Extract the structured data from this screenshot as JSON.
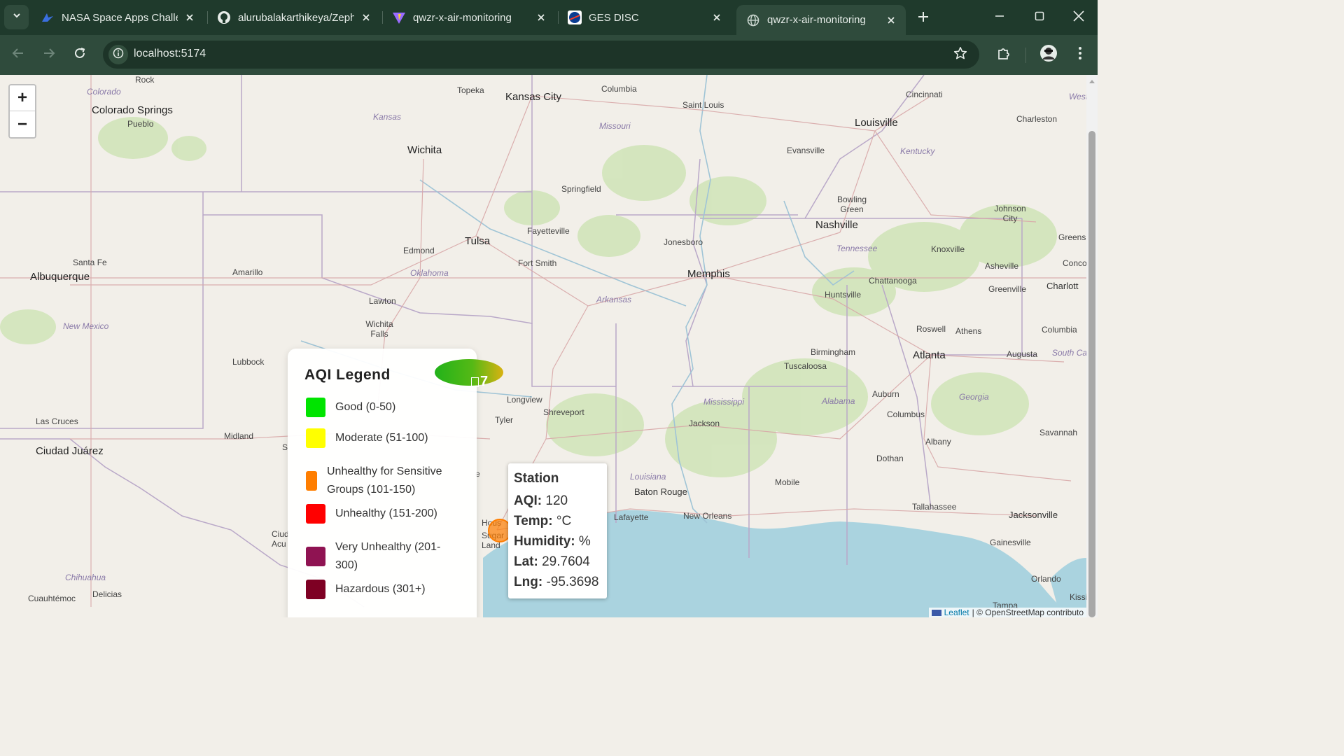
{
  "browser": {
    "tabs": [
      {
        "title": "NASA Space Apps Challe",
        "icon": "space-apps-icon"
      },
      {
        "title": "alurubalakarthikeya/Zeph",
        "icon": "github-icon"
      },
      {
        "title": "qwzr-x-air-monitoring",
        "icon": "vite-icon"
      },
      {
        "title": "GES DISC",
        "icon": "nasa-icon"
      },
      {
        "title": "qwzr-x-air-monitoring",
        "icon": "globe-icon",
        "active": true
      }
    ],
    "url": "localhost:5174"
  },
  "map": {
    "zoom_in_label": "+",
    "zoom_out_label": "−",
    "labels": {
      "rock": "Rock",
      "colorado": "Colorado",
      "colorado_springs": "Colorado Springs",
      "pueblo": "Pueblo",
      "kansas": "Kansas",
      "topeka": "Topeka",
      "kansas_city": "Kansas City",
      "columbia_mo": "Columbia",
      "saint_louis": "Saint Louis",
      "missouri": "Missouri",
      "cincinnati": "Cincinnati",
      "louisville": "Louisville",
      "charleston": "Charleston",
      "wichita": "Wichita",
      "evansville": "Evansville",
      "kentucky": "Kentucky",
      "springfield": "Springfield",
      "bowling_green": "Bowling Green",
      "johnson_city": "Johnson City",
      "fayetteville": "Fayetteville",
      "nashville": "Nashville",
      "tulsa": "Tulsa",
      "edmond": "Edmond",
      "jonesboro": "Jonesboro",
      "tennessee": "Tennessee",
      "knoxville": "Knoxville",
      "greens": "Greens",
      "santa_fe": "Santa Fe",
      "albuquerque": "Albuquerque",
      "amarillo": "Amarillo",
      "oklahoma": "Oklahoma",
      "fort_smith": "Fort Smith",
      "memphis": "Memphis",
      "chattanooga": "Chattanooga",
      "asheville": "Asheville",
      "conco": "Conco",
      "charlotte": "Charlott",
      "greenville": "Greenville",
      "huntsville": "Huntsville",
      "lawton": "Lawton",
      "arkansas": "Arkansas",
      "new_mexico": "New Mexico",
      "wichita_falls": "Wichita Falls",
      "roswell": "Roswell",
      "athens": "Athens",
      "columbia_sc": "Columbia",
      "birmingham": "Birmingham",
      "lubbock": "Lubbock",
      "atlanta": "Atlanta",
      "augusta": "Augusta",
      "south_ca": "South Ca",
      "tuscaloosa": "Tuscaloosa",
      "longview": "Longview",
      "shreveport": "Shreveport",
      "auburn": "Auburn",
      "mississippi": "Mississippi",
      "alabama": "Alabama",
      "georgia": "Georgia",
      "columbus": "Columbus",
      "las_cruces": "Las Cruces",
      "tyler": "Tyler",
      "jackson": "Jackson",
      "midland": "Midland",
      "savannah": "Savannah",
      "albany": "Albany",
      "ciudad_juarez": "Ciudad Juárez",
      "dothan": "Dothan",
      "louisiana": "Louisiana",
      "mobile": "Mobile",
      "baton_rouge": "Baton Rouge",
      "tallahassee": "Tallahassee",
      "lafayette": "Lafayette",
      "new_orleans": "New Orleans",
      "jacksonville": "Jacksonville",
      "hous": "Hous",
      "sugar_land": "Sugar Land",
      "ciud_acu": "Ciud Acu",
      "gainesville": "Gainesville",
      "chihuahua": "Chihuahua",
      "orlando": "Orlando",
      "cuauhtemoc": "Cuauhtémoc",
      "delicias": "Delicias",
      "tampa": "Tampa",
      "kissimm": "Kissimm",
      "west": "West",
      "s_partial": "S",
      "s_partial2": "e"
    },
    "attribution": {
      "leaflet": "Leaflet",
      "rest": "| © OpenStreetMap contributo"
    }
  },
  "legend": {
    "title": "AQI Legend",
    "items": [
      {
        "label": "Good (0-50)",
        "color": "#00e400"
      },
      {
        "label": "Moderate (51-100)",
        "color": "#ffff00"
      },
      {
        "label": "Unhealthy for Sensitive Groups (101-150)",
        "color": "#ff7e00"
      },
      {
        "label": "Unhealthy (151-200)",
        "color": "#ff0000"
      },
      {
        "label": "Very Unhealthy (201-300)",
        "color": "#8f1352"
      },
      {
        "label": "Hazardous (301+)",
        "color": "#7e0023"
      }
    ]
  },
  "cluster_marker": {
    "count": "7"
  },
  "popup": {
    "title": "Station",
    "aqi_label": "AQI:",
    "aqi": "120",
    "temp_label": "Temp:",
    "temp": "°C",
    "humidity_label": "Humidity:",
    "humidity": "%",
    "lat_label": "Lat:",
    "lat": "29.7604",
    "lng_label": "Lng:",
    "lng": "-95.3698"
  }
}
